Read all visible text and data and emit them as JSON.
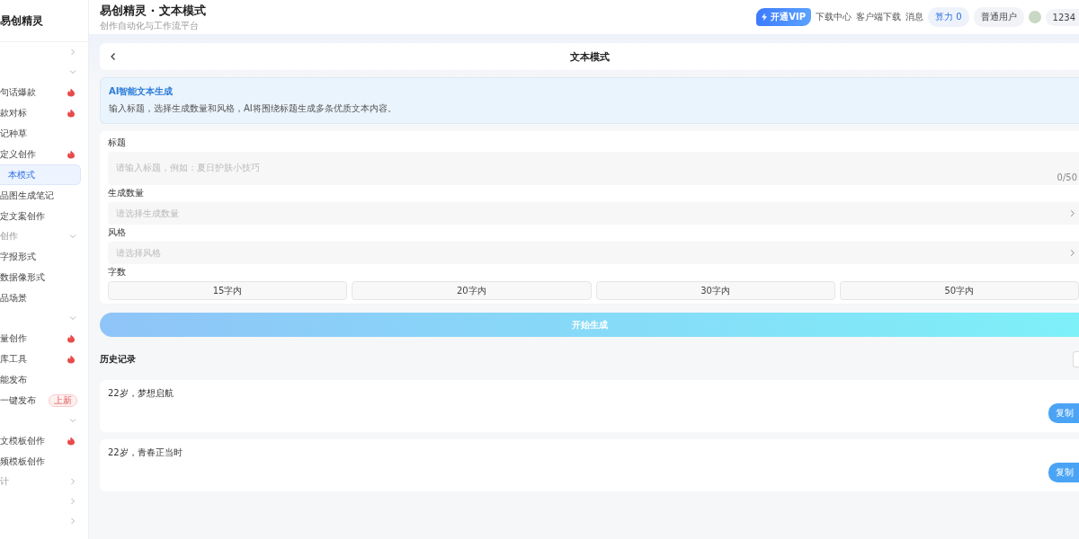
{
  "sidebar": {
    "title": "易创精灵",
    "items": [
      {
        "kind": "group",
        "expanded": false
      },
      {
        "kind": "group",
        "expanded": true
      },
      {
        "kind": "item",
        "label": "句话爆款",
        "hot": true,
        "selected": false
      },
      {
        "kind": "item",
        "label": "款对标",
        "hot": true,
        "selected": false
      },
      {
        "kind": "item",
        "label": "记种草",
        "hot": false,
        "selected": false
      },
      {
        "kind": "item",
        "label": "定义创作",
        "hot": true,
        "selected": false
      },
      {
        "kind": "item",
        "label": "本模式",
        "hot": false,
        "selected": true
      },
      {
        "kind": "item",
        "label": "品图生成笔记",
        "hot": false,
        "selected": false
      },
      {
        "kind": "item",
        "label": "定文案创作",
        "hot": false,
        "selected": false
      },
      {
        "kind": "group",
        "label": "创作",
        "expanded": true
      },
      {
        "kind": "item",
        "label": "字报形式",
        "hot": false,
        "selected": false
      },
      {
        "kind": "item",
        "label": "数据像形式",
        "hot": false,
        "selected": false
      },
      {
        "kind": "item",
        "label": "品场景",
        "hot": false,
        "selected": false
      },
      {
        "kind": "group",
        "expanded": true
      },
      {
        "kind": "item",
        "label": "量创作",
        "hot": true,
        "selected": false
      },
      {
        "kind": "item",
        "label": "库工具",
        "hot": true,
        "selected": false
      },
      {
        "kind": "item",
        "label": "能发布",
        "hot": false,
        "selected": false
      },
      {
        "kind": "item",
        "label": "一键发布",
        "hot": false,
        "selected": false,
        "badge": "上新"
      },
      {
        "kind": "group",
        "expanded": true
      },
      {
        "kind": "item",
        "label": "文模板创作",
        "hot": true,
        "selected": false
      },
      {
        "kind": "item",
        "label": "频模板创作",
        "hot": false,
        "selected": false
      },
      {
        "kind": "group",
        "label": "计",
        "expanded": false
      },
      {
        "kind": "group",
        "expanded": false
      },
      {
        "kind": "group",
        "expanded": false
      }
    ]
  },
  "header": {
    "title": "易创精灵 · 文本模式",
    "subtitle": "创作自动化与工作流平台",
    "vip": "开通VIP",
    "links": [
      "下载中心",
      "客户端下载",
      "消息"
    ],
    "power": "算力 0",
    "role": "普通用户",
    "user": "1234"
  },
  "page": {
    "title": "文本模式"
  },
  "intro": {
    "title": "AI智能文本生成",
    "text": "输入标题，选择生成数量和风格，AI将围绕标题生成多条优质文本内容。"
  },
  "form": {
    "title_label": "标题",
    "title_placeholder": "请输入标题，例如：夏日护肤小技巧",
    "counter": "0/50",
    "count_label": "生成数量",
    "count_placeholder": "请选择生成数量",
    "style_label": "风格",
    "style_placeholder": "请选择风格",
    "length_label": "字数",
    "lengths": [
      {
        "label": "15字内",
        "selected": false
      },
      {
        "label": "20字内",
        "selected": false
      },
      {
        "label": "30字内",
        "selected": false
      },
      {
        "label": "50字内",
        "selected": false
      }
    ]
  },
  "generate": {
    "label": "开始生成",
    "disabled": true
  },
  "history": {
    "title": "历史记录",
    "records": [
      {
        "text": "22岁，梦想启航",
        "copy": "复制"
      },
      {
        "text": "22岁，青春正当时",
        "copy": "复制"
      }
    ]
  }
}
